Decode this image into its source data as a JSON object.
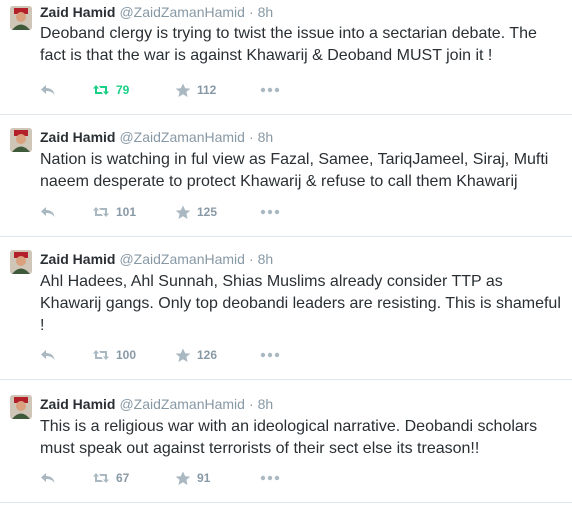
{
  "colors": {
    "retweeted": "#19cf86",
    "muted": "#8899a6",
    "text": "#292f33",
    "divider": "#e1e8ed"
  },
  "tweets": [
    {
      "author": "Zaid Hamid",
      "handle": "@ZaidZamanHamid",
      "separator": "·",
      "time": "8h",
      "text": "Deoband clergy is trying to twist the issue into a sectarian debate. The fact is that the war is against Khawarij & Deoband MUST join it !",
      "retweets": "79",
      "retweeted": true,
      "favorites": "112"
    },
    {
      "author": "Zaid Hamid",
      "handle": "@ZaidZamanHamid",
      "separator": "·",
      "time": "8h",
      "text": "Nation is watching in ful view as Fazal, Samee, TariqJameel, Siraj, Mufti naeem desperate to protect Khawarij & refuse to call them Khawarij",
      "retweets": "101",
      "retweeted": false,
      "favorites": "125"
    },
    {
      "author": "Zaid Hamid",
      "handle": "@ZaidZamanHamid",
      "separator": "·",
      "time": "8h",
      "text": "Ahl Hadees, Ahl Sunnah, Shias Muslims already consider TTP as Khawarij gangs. Only top deobandi leaders are resisting. This is shameful !",
      "retweets": "100",
      "retweeted": false,
      "favorites": "126"
    },
    {
      "author": "Zaid Hamid",
      "handle": "@ZaidZamanHamid",
      "separator": "·",
      "time": "8h",
      "text": "This is a religious war with an ideological narrative. Deobandi scholars must speak out against terrorists of their sect else its treason!!",
      "retweets": "67",
      "retweeted": false,
      "favorites": "91"
    }
  ],
  "icons": {
    "reply": "reply-icon",
    "retweet": "retweet-icon",
    "favorite": "star-icon",
    "more": "more-icon"
  }
}
